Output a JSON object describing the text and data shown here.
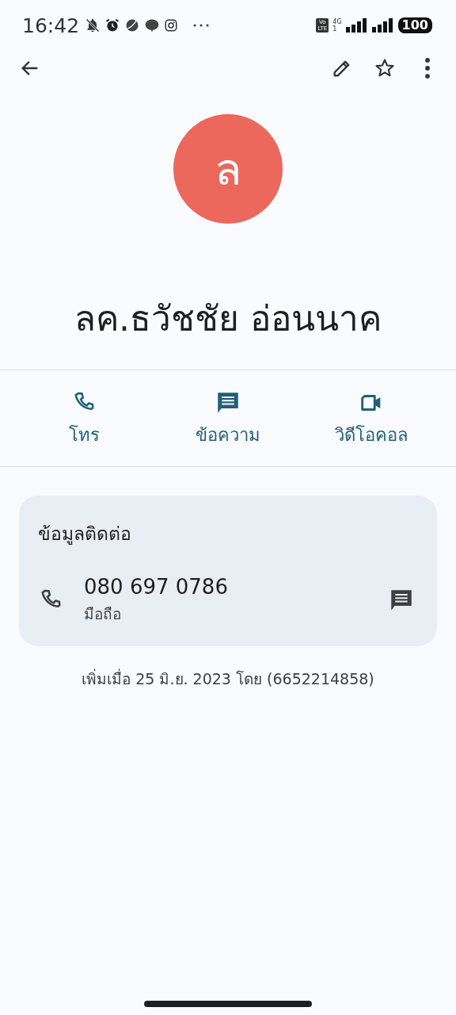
{
  "status_bar": {
    "time": "16:42",
    "volte": "Vo LTE",
    "network": "4G",
    "sim": "1",
    "battery": "100"
  },
  "avatar": {
    "letter": "ล",
    "color": "#ec675c"
  },
  "contact_name": "ลค.ธวัชชัย อ่อนนาค",
  "actions": [
    {
      "kind": "call",
      "label": "โทร"
    },
    {
      "kind": "message",
      "label": "ข้อความ"
    },
    {
      "kind": "video",
      "label": "วิดีโอคอล"
    }
  ],
  "contact_info": {
    "title": "ข้อมูลติดต่อ",
    "phone": "080 697 0786",
    "phone_type": "มือถือ"
  },
  "added_note": "เพิ่มเมื่อ 25 มิ.ย. 2023 โดย (6652214858)"
}
